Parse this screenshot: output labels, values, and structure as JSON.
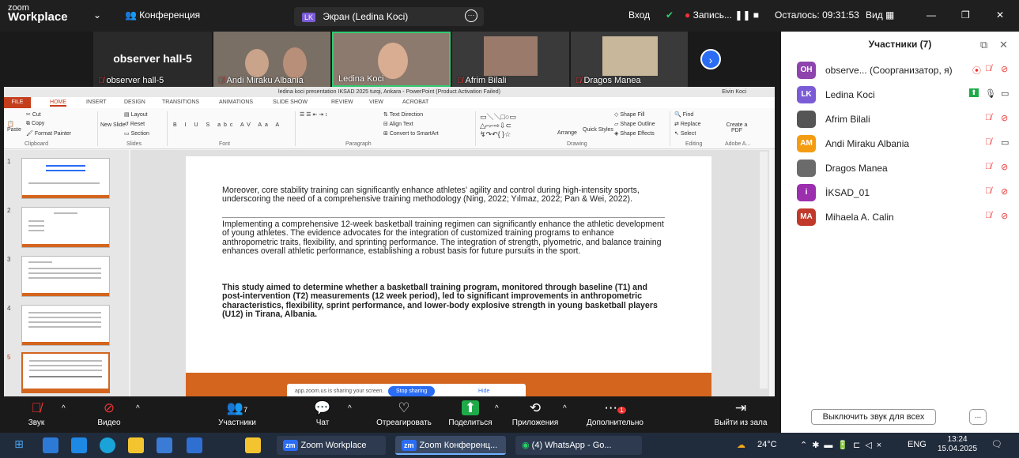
{
  "topbar": {
    "brand_top": "zoom",
    "brand_bottom": "Workplace",
    "meeting_label": "Конференция",
    "share_initials": "LK",
    "share_label": "Экран (Ledina Koci)",
    "login": "Вход",
    "recording": "Запись...",
    "remaining": "Осталось: 09:31:53",
    "view": "Вид"
  },
  "strip": {
    "tiles": [
      {
        "big": "observer hall-5",
        "name": "observer hall-5"
      },
      {
        "name": "Andi Miraku Albania"
      },
      {
        "name": "Ledina Koci"
      },
      {
        "name": "Afrim Bilali"
      },
      {
        "name": "Dragos Manea"
      }
    ]
  },
  "ppt": {
    "title": "ledina koci presentation IKSAD 2025 turqi, Ankara - PowerPoint (Product Activation Failed)",
    "user": "Eivin Koci",
    "tabs": [
      "FILE",
      "HOME",
      "INSERT",
      "DESIGN",
      "TRANSITIONS",
      "ANIMATIONS",
      "SLIDE SHOW",
      "REVIEW",
      "VIEW",
      "ACROBAT"
    ],
    "ribbon": {
      "cut": "Cut",
      "copy": "Copy",
      "paste": "Paste",
      "format_painter": "Format Painter",
      "clipboard": "Clipboard",
      "new_slide": "New Slide",
      "layout": "Layout",
      "reset": "Reset",
      "section": "Section",
      "slides": "Slides",
      "font": "Font",
      "paragraph": "Paragraph",
      "text_direction": "Text Direction",
      "align_text": "Align Text",
      "convert_smartart": "Convert to SmartArt",
      "drawing": "Drawing",
      "arrange": "Arrange",
      "quick_styles": "Quick Styles",
      "shape_fill": "Shape Fill",
      "shape_outline": "Shape Outline",
      "shape_effects": "Shape Effects",
      "find": "Find",
      "replace": "Replace",
      "select": "Select",
      "editing": "Editing",
      "create_pdf": "Create a PDF",
      "adobe": "Adobe A..."
    },
    "slide_numbers": [
      "1",
      "2",
      "3",
      "4",
      "5"
    ],
    "slide": {
      "p1": "Moreover, core stability training can significantly enhance athletes' agility and control during high-intensity sports, underscoring the need of a comprehensive training methodology (Ning, 2022; Yılmaz, 2022; Pan & Wei, 2022).",
      "p2": "Implementing a comprehensive 12-week basketball training regimen can significantly enhance the athletic development of young athletes. The evidence advocates for the integration of customized training programs to enhance anthropometric traits, flexibility, and sprinting performance. The integration of strength, plyometric, and balance training enhances overall athletic performance, establishing a robust basis for future pursuits in the sport.",
      "p3": "This study aimed to determine whether a basketball training program, monitored through baseline (T1) and post-intervention (T2) measurements (12 week period), led to significant improvements in anthropometric characteristics, flexibility, sprint performance, and lower-body explosive strength in young basketball players (U12) in Tirana, Albania."
    },
    "share_bar": {
      "text": "app.zoom.us is sharing your screen.",
      "stop": "Stop sharing",
      "hide": "Hide"
    }
  },
  "panel": {
    "title": "Участники (7)",
    "participants": [
      {
        "initials": "OH",
        "name": "observe... (Соорганизатор, я)",
        "color": "#8e44ad"
      },
      {
        "initials": "LK",
        "name": "Ledina Koci",
        "color": "#7b5cd6"
      },
      {
        "initials": "",
        "name": "Afrim Bilali",
        "color": "#555555"
      },
      {
        "initials": "AM",
        "name": "Andi Miraku Albania",
        "color": "#f39c12"
      },
      {
        "initials": "",
        "name": "Dragos Manea",
        "color": "#6b6b6b"
      },
      {
        "initials": "i",
        "name": "İKSAD_01",
        "color": "#9b2fae"
      },
      {
        "initials": "MA",
        "name": "Mihaela A. Calin",
        "color": "#c0392b"
      }
    ],
    "mute_all": "Выключить звук для всех",
    "more": "..."
  },
  "toolbar": {
    "audio": "Звук",
    "video": "Видео",
    "participants": "Участники",
    "participants_count": "7",
    "chat": "Чат",
    "react": "Отреагировать",
    "share": "Поделиться",
    "apps": "Приложения",
    "more": "Дополнительно",
    "more_badge": "1",
    "leave": "Выйти из зала"
  },
  "taskbar": {
    "apps": [
      "Zoom Workplace",
      "Zoom Конференц...",
      "(4) WhatsApp - Go..."
    ],
    "temp": "24°C",
    "lang": "ENG",
    "time": "13:24",
    "date": "15.04.2025"
  }
}
